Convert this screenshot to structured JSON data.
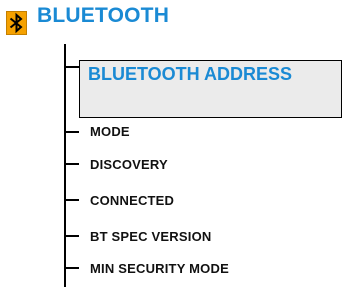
{
  "header": {
    "title": "BLUETOOTH",
    "icon": "bluetooth-icon",
    "icon_bg_color": "#f5a100",
    "accent_color": "#1a8ad4"
  },
  "menu": {
    "selected": "BLUETOOTH ADDRESS",
    "items": [
      "MODE",
      "DISCOVERY",
      "CONNECTED",
      "BT SPEC VERSION",
      "MIN SECURITY MODE"
    ]
  }
}
